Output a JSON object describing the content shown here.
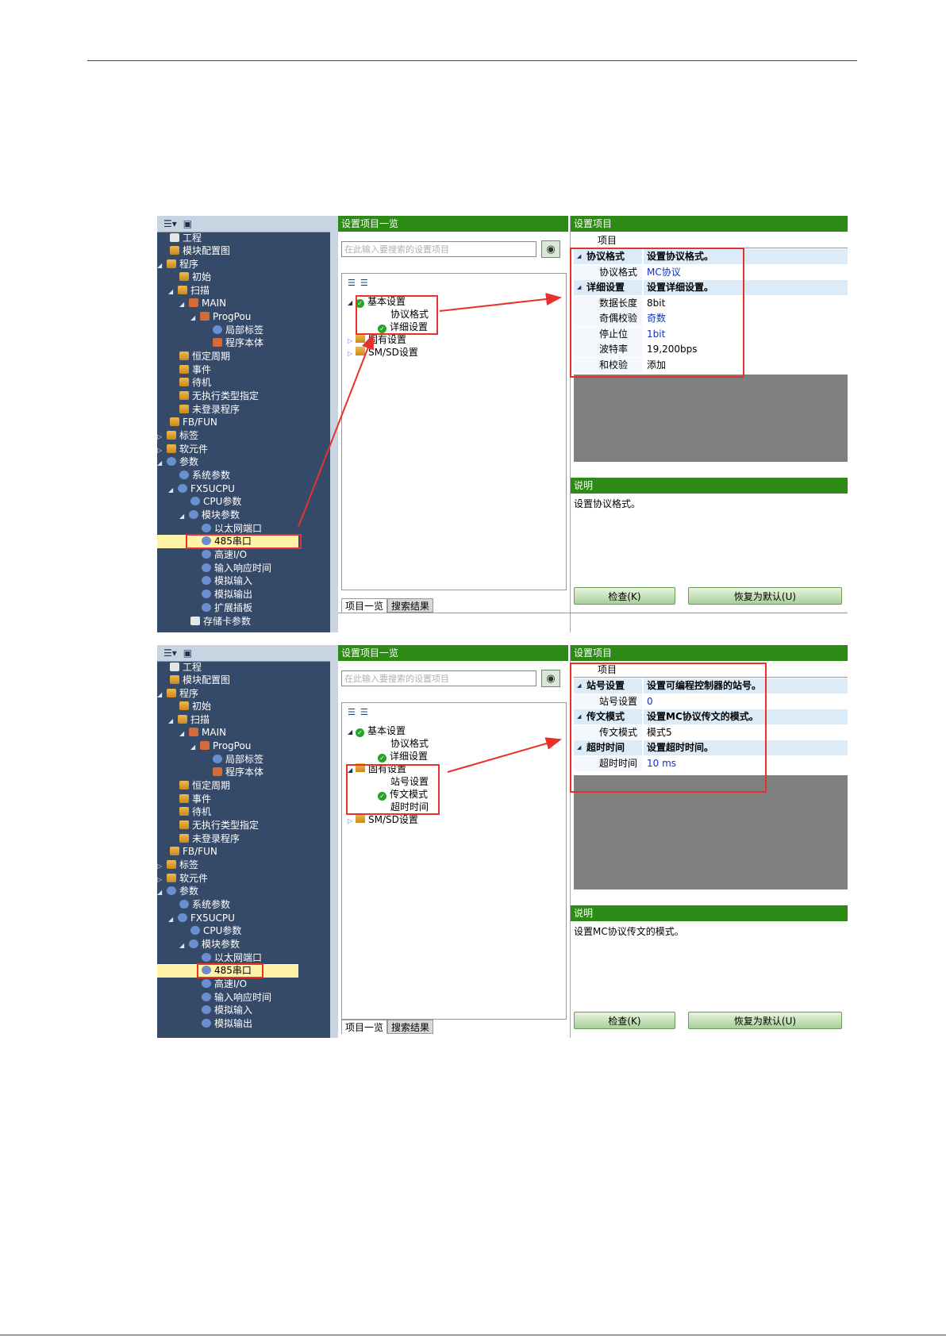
{
  "accent_colors": {
    "title_bar": "#2d8a16",
    "tree_bg": "#354a69",
    "annotation": "#e8302c",
    "selection": "#fff3a8"
  },
  "tree_toolbar_icons": [
    "tree-filter-icon",
    "collapse-icon"
  ],
  "common": {
    "list_pane_title": "设置项目一览",
    "settings_pane_title": "设置项目",
    "search_placeholder": "在此输入要搜索的设置项目",
    "grid_header": "项目",
    "description_title": "说明",
    "tab_list": "项目一览",
    "tab_search": "搜索结果",
    "check_button": "检查(K)",
    "restore_button": "恢复为默认(U)"
  },
  "tree": {
    "project": "工程",
    "module_config": "模块配置图",
    "program": "程序",
    "initial": "初始",
    "scan": "扫描",
    "main": "MAIN",
    "progpou": "ProgPou",
    "local_label": "局部标签",
    "program_body": "程序本体",
    "fixed_cycle": "恒定周期",
    "event": "事件",
    "standby": "待机",
    "no_type": "无执行类型指定",
    "unregistered": "未登录程序",
    "fbfun": "FB/FUN",
    "label": "标签",
    "device": "软元件",
    "parameter": "参数",
    "system_param": "系统参数",
    "fx5ucpu": "FX5UCPU",
    "cpu_param": "CPU参数",
    "module_param": "模块参数",
    "ethernet": "以太网端口",
    "rs485": "485串口",
    "highspeed": "高速I/O",
    "input_response": "输入响应时间",
    "analog_in": "模拟输入",
    "analog_out": "模拟输出",
    "expansion": "扩展插板",
    "memory_card": "存储卡参数"
  },
  "list": {
    "basic": "基本设置",
    "protocol_format": "协议格式",
    "detail": "详细设置",
    "fixed": "固有设置",
    "station": "站号设置",
    "transmission": "传文模式",
    "timeout": "超时时间",
    "smsd": "SM/SD设置"
  },
  "shot1": {
    "rows": [
      {
        "k": "协议格式",
        "v": "设置协议格式。",
        "cat": true
      },
      {
        "k": "协议格式",
        "v": "MC协议",
        "blue": true
      },
      {
        "k": "详细设置",
        "v": "设置详细设置。",
        "cat": true
      },
      {
        "k": "数据长度",
        "v": "8bit"
      },
      {
        "k": "奇偶校验",
        "v": "奇数",
        "blue": true
      },
      {
        "k": "停止位",
        "v": "1bit",
        "blue": true
      },
      {
        "k": "波特率",
        "v": "19,200bps"
      },
      {
        "k": "和校验",
        "v": "添加"
      }
    ],
    "description": "设置协议格式。"
  },
  "shot2": {
    "rows": [
      {
        "k": "站号设置",
        "v": "设置可编程控制器的站号。",
        "cat": true
      },
      {
        "k": "站号设置",
        "v": "0",
        "blue": true
      },
      {
        "k": "传文模式",
        "v": "设置MC协议传文的模式。",
        "cat": true
      },
      {
        "k": "传文模式",
        "v": "模式5"
      },
      {
        "k": "超时时间",
        "v": "设置超时时间。",
        "cat": true
      },
      {
        "k": "超时时间",
        "v": "10 ms",
        "blue": true
      }
    ],
    "description": "设置MC协议传文的模式。"
  }
}
